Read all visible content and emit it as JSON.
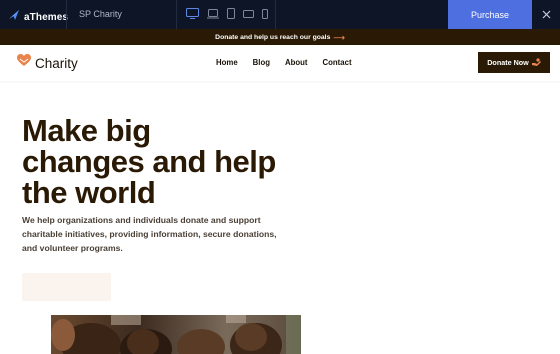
{
  "demobar": {
    "brand": "aThemes",
    "theme_name": "SP Charity",
    "devices": [
      "desktop-icon",
      "laptop-icon",
      "tablet-portrait-icon",
      "tablet-landscape-icon",
      "phone-icon"
    ],
    "purchase_label": "Purchase"
  },
  "announcement": {
    "text": "Donate and help us reach our goals",
    "arrow": "⟶"
  },
  "header": {
    "logo_text": "Charity",
    "nav": [
      "Home",
      "Blog",
      "About",
      "Contact"
    ],
    "donate_label": "Donate Now"
  },
  "hero": {
    "title_lines": [
      "Make big",
      "changes and help",
      "the world"
    ],
    "description_lines": [
      "We help organizations and individuals donate and support",
      "charitable initiatives, providing information, secure donations,",
      "and volunteer programs."
    ]
  },
  "colors": {
    "demobar_bg": "#0d1526",
    "purchase_bg": "#4d6fe0",
    "brand_dark": "#2a1a05",
    "accent_orange": "#e9844d"
  }
}
